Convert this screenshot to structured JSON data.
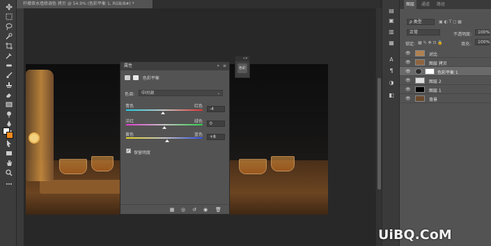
{
  "document": {
    "tab_title": "柠檬茶水墙修调色 拷贝 @ 54.9% (色彩平衡 1, RGB/8#) *"
  },
  "colors": {
    "foreground": "#ffffff",
    "background": "#f28a1c",
    "panel": "#535353",
    "dark": "#2b2b2b"
  },
  "toolbar": {
    "tools": [
      "move-icon",
      "marquee-icon",
      "lasso-icon",
      "quick-select-icon",
      "crop-icon",
      "eyedropper-icon",
      "healing-icon",
      "brush-icon",
      "stamp-icon",
      "history-brush-icon",
      "eraser-icon",
      "gradient-icon",
      "blur-icon",
      "dodge-icon",
      "pen-icon",
      "type-icon",
      "path-select-icon",
      "shape-icon",
      "hand-icon",
      "zoom-icon"
    ]
  },
  "properties_panel": {
    "title": "属性",
    "adjustment_name": "色彩平衡",
    "tone_label": "色调:",
    "tone_value": "中间调",
    "sliders": [
      {
        "left": "青色",
        "right": "红色",
        "value": "-4",
        "level": 0.48
      },
      {
        "left": "洋红",
        "right": "绿色",
        "value": "0",
        "level": 0.5
      },
      {
        "left": "黄色",
        "right": "蓝色",
        "value": "+8",
        "level": 0.54
      }
    ],
    "preserve_luminosity": "保留明度",
    "preserve_checked": "✓"
  },
  "mini_panel": {
    "label": "色彩"
  },
  "layers_panel": {
    "tabs": [
      "图层",
      "通道",
      "路径"
    ],
    "filter_label": "ρ 类型",
    "blend_mode": "正常",
    "opacity_label": "不透明度:",
    "opacity": "100%",
    "lock_label": "锁定:",
    "fill_label": "填充:",
    "fill": "100%",
    "layers": [
      {
        "name": "对比",
        "selected": false
      },
      {
        "name": "图层 拷贝",
        "selected": false
      },
      {
        "name": "色彩平衡 1",
        "selected": true
      },
      {
        "name": "图层 2",
        "selected": false
      },
      {
        "name": "图层 1",
        "selected": false
      },
      {
        "name": "背景",
        "selected": false
      }
    ]
  },
  "watermark": "UiBQ.CoM"
}
